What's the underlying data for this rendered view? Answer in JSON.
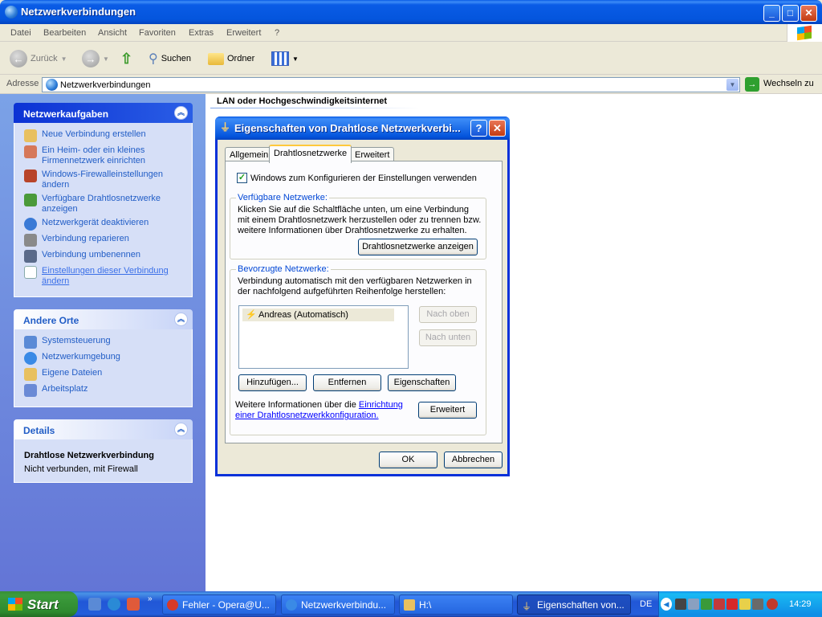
{
  "window": {
    "title": "Netzwerkverbindungen",
    "min": "_",
    "max": "□",
    "close": "✕"
  },
  "menu": [
    "Datei",
    "Bearbeiten",
    "Ansicht",
    "Favoriten",
    "Extras",
    "Erweitert",
    "?"
  ],
  "toolbar": {
    "back": "Zurück",
    "search": "Suchen",
    "folders": "Ordner"
  },
  "address": {
    "label": "Adresse",
    "value": "Netzwerkverbindungen",
    "go": "Wechseln zu"
  },
  "left": {
    "tasks": {
      "title": "Netzwerkaufgaben",
      "items": [
        "Neue Verbindung erstellen",
        "Ein Heim- oder ein kleines Firmennetzwerk einrichten",
        "Windows-Firewalleinstellungen ändern",
        "Verfügbare Drahtlosnetzwerke anzeigen",
        "Netzwerkgerät deaktivieren",
        "Verbindung reparieren",
        "Verbindung umbenennen",
        "Einstellungen dieser Verbindung ändern"
      ]
    },
    "places": {
      "title": "Andere Orte",
      "items": [
        "Systemsteuerung",
        "Netzwerkumgebung",
        "Eigene Dateien",
        "Arbeitsplatz"
      ]
    },
    "details": {
      "title": "Details",
      "name": "Drahtlose Netzwerkverbindung",
      "status": "Nicht verbunden, mit Firewall"
    }
  },
  "main": {
    "group": "LAN oder Hochgeschwindigkeitsinternet"
  },
  "dialog": {
    "title": "Eigenschaften von Drahtlose Netzwerkverbi...",
    "help": "?",
    "close": "✕",
    "tabs": [
      "Allgemein",
      "Drahtlosnetzwerke",
      "Erweitert"
    ],
    "checkbox": "Windows zum Konfigurieren der Einstellungen verwenden",
    "available": {
      "label": "Verfügbare Netzwerke:",
      "text": "Klicken Sie auf die Schaltfläche unten, um eine Verbindung mit einem Drahtlosnetzwerk herzustellen oder zu trennen bzw. weitere Informationen über Drahtlosnetzwerke zu erhalten.",
      "button": "Drahtlosnetzwerke anzeigen"
    },
    "preferred": {
      "label": "Bevorzugte Netzwerke:",
      "text": "Verbindung automatisch mit den verfügbaren Netzwerken in der nachfolgend aufgeführten Reihenfolge herstellen:",
      "items": [
        "Andreas (Automatisch)"
      ],
      "up": "Nach oben",
      "down": "Nach unten",
      "add": "Hinzufügen...",
      "remove": "Entfernen",
      "props": "Eigenschaften"
    },
    "info_prefix": "Weitere Informationen über die ",
    "info_link": "Einrichtung einer Drahtlosnetzwerkkonfiguration.",
    "advanced": "Erweitert",
    "ok": "OK",
    "cancel": "Abbrechen"
  },
  "taskbar": {
    "start": "Start",
    "buttons": [
      "Fehler - Opera@U...",
      "Netzwerkverbindu...",
      "H:\\",
      "Eigenschaften von..."
    ],
    "lang": "DE",
    "time": "14:29",
    "more": "»"
  }
}
